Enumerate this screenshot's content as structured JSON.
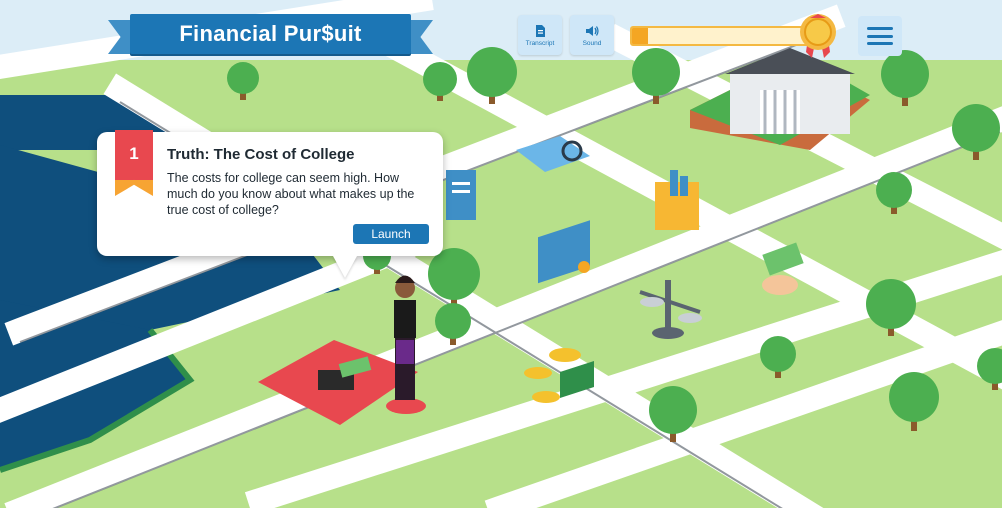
{
  "header": {
    "title": "Financial Pur$uit",
    "transcript_label": "Transcript",
    "sound_label": "Sound"
  },
  "progress": {
    "value": 0.08
  },
  "popup": {
    "number": "1",
    "title": "Truth: The Cost of College",
    "description": "The costs for college can seem high. How much do you know about what makes up the true cost of college?",
    "launch_label": "Launch"
  },
  "colors": {
    "primary_blue": "#1c76b5",
    "light_blue": "#cfe7f8",
    "grass": "#b7e08a",
    "road": "#ffffff",
    "river": "#0f4f7d",
    "ribbon_red": "#e8484f",
    "ribbon_orange": "#f7a433"
  },
  "icons": [
    "transcript-icon",
    "sound-icon",
    "medal-icon",
    "menu-icon"
  ]
}
